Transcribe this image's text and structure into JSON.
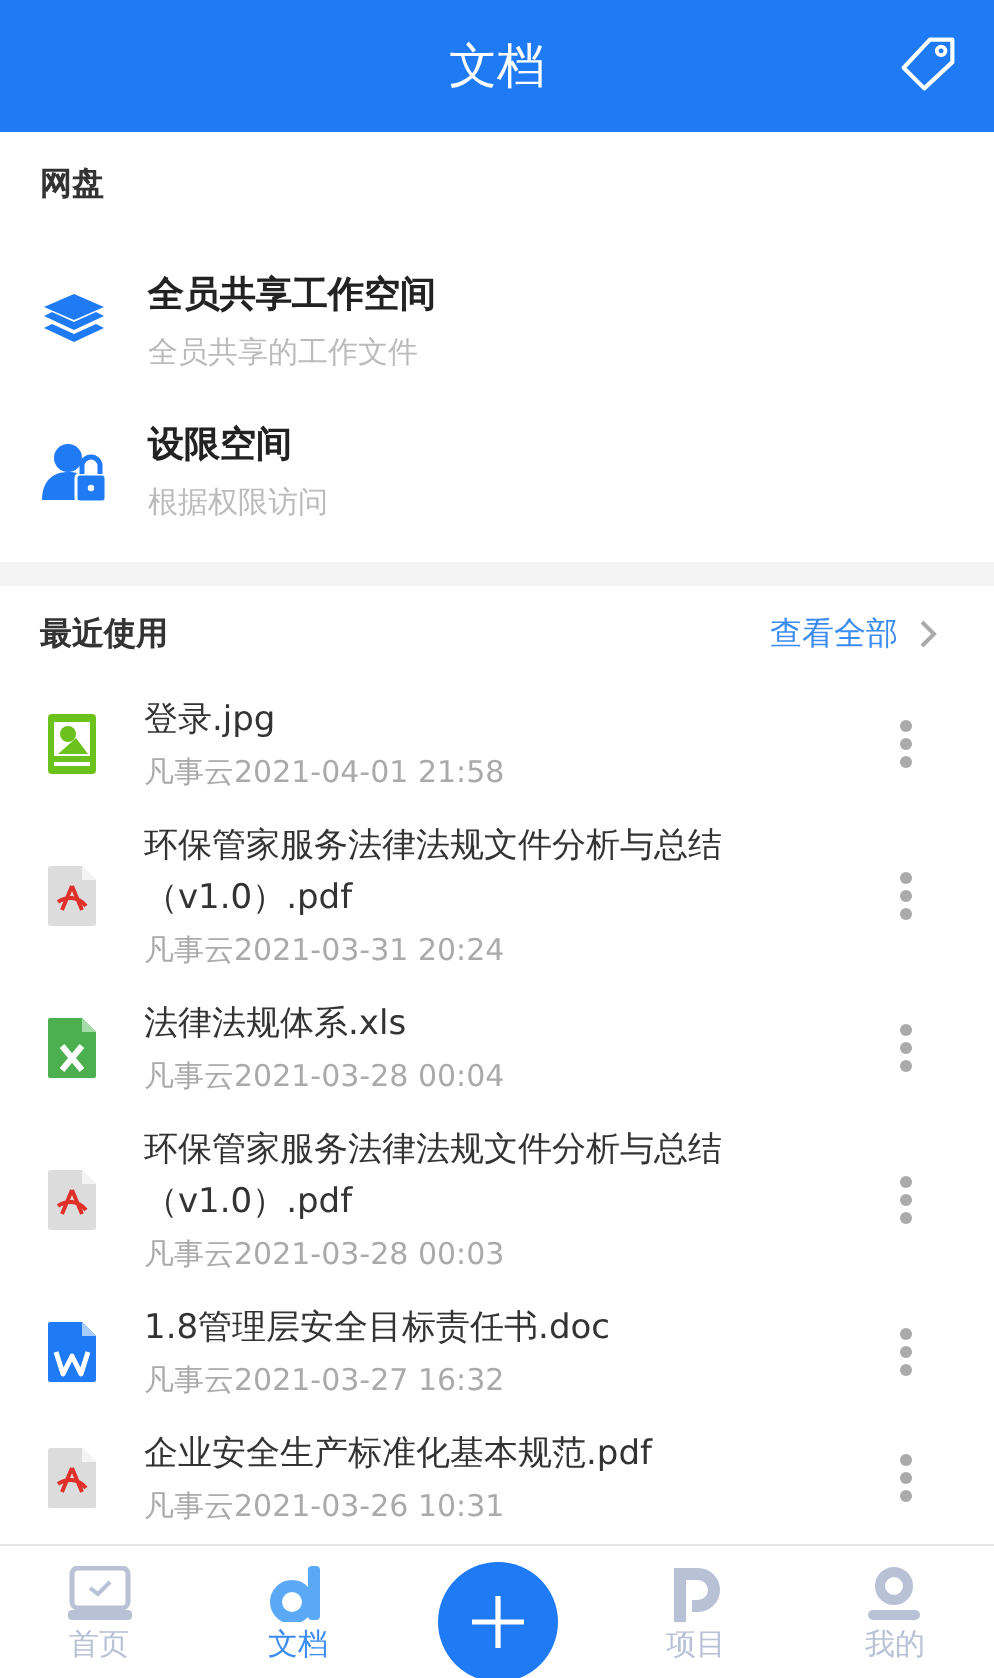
{
  "header": {
    "title": "文档"
  },
  "netdisk": {
    "title": "网盘",
    "items": [
      {
        "kind": "shared",
        "name": "全员共享工作空间",
        "desc": "全员共享的工作文件"
      },
      {
        "kind": "restricted",
        "name": "设限空间",
        "desc": "根据权限访问"
      }
    ]
  },
  "recent": {
    "title": "最近使用",
    "view_all": "查看全部",
    "files": [
      {
        "kind": "image",
        "name": "登录.jpg",
        "meta": "凡事云2021-04-01 21:58"
      },
      {
        "kind": "pdf",
        "name": "环保管家服务法律法规文件分析与总结（v1.0）.pdf",
        "meta": "凡事云2021-03-31 20:24"
      },
      {
        "kind": "xls",
        "name": "法律法规体系.xls",
        "meta": "凡事云2021-03-28 00:04"
      },
      {
        "kind": "pdf",
        "name": "环保管家服务法律法规文件分析与总结（v1.0）.pdf",
        "meta": "凡事云2021-03-28 00:03"
      },
      {
        "kind": "doc",
        "name": "1.8管理层安全目标责任书.doc",
        "meta": "凡事云2021-03-27 16:32"
      },
      {
        "kind": "pdf",
        "name": "企业安全生产标准化基本规范.pdf",
        "meta": "凡事云2021-03-26 10:31"
      }
    ]
  },
  "tabbar": [
    {
      "kind": "home",
      "label": "首页",
      "selected": false
    },
    {
      "kind": "docs",
      "label": "文档",
      "selected": true
    },
    {
      "kind": "add"
    },
    {
      "kind": "project",
      "label": "项目",
      "selected": false
    },
    {
      "kind": "me",
      "label": "我的",
      "selected": false
    }
  ]
}
